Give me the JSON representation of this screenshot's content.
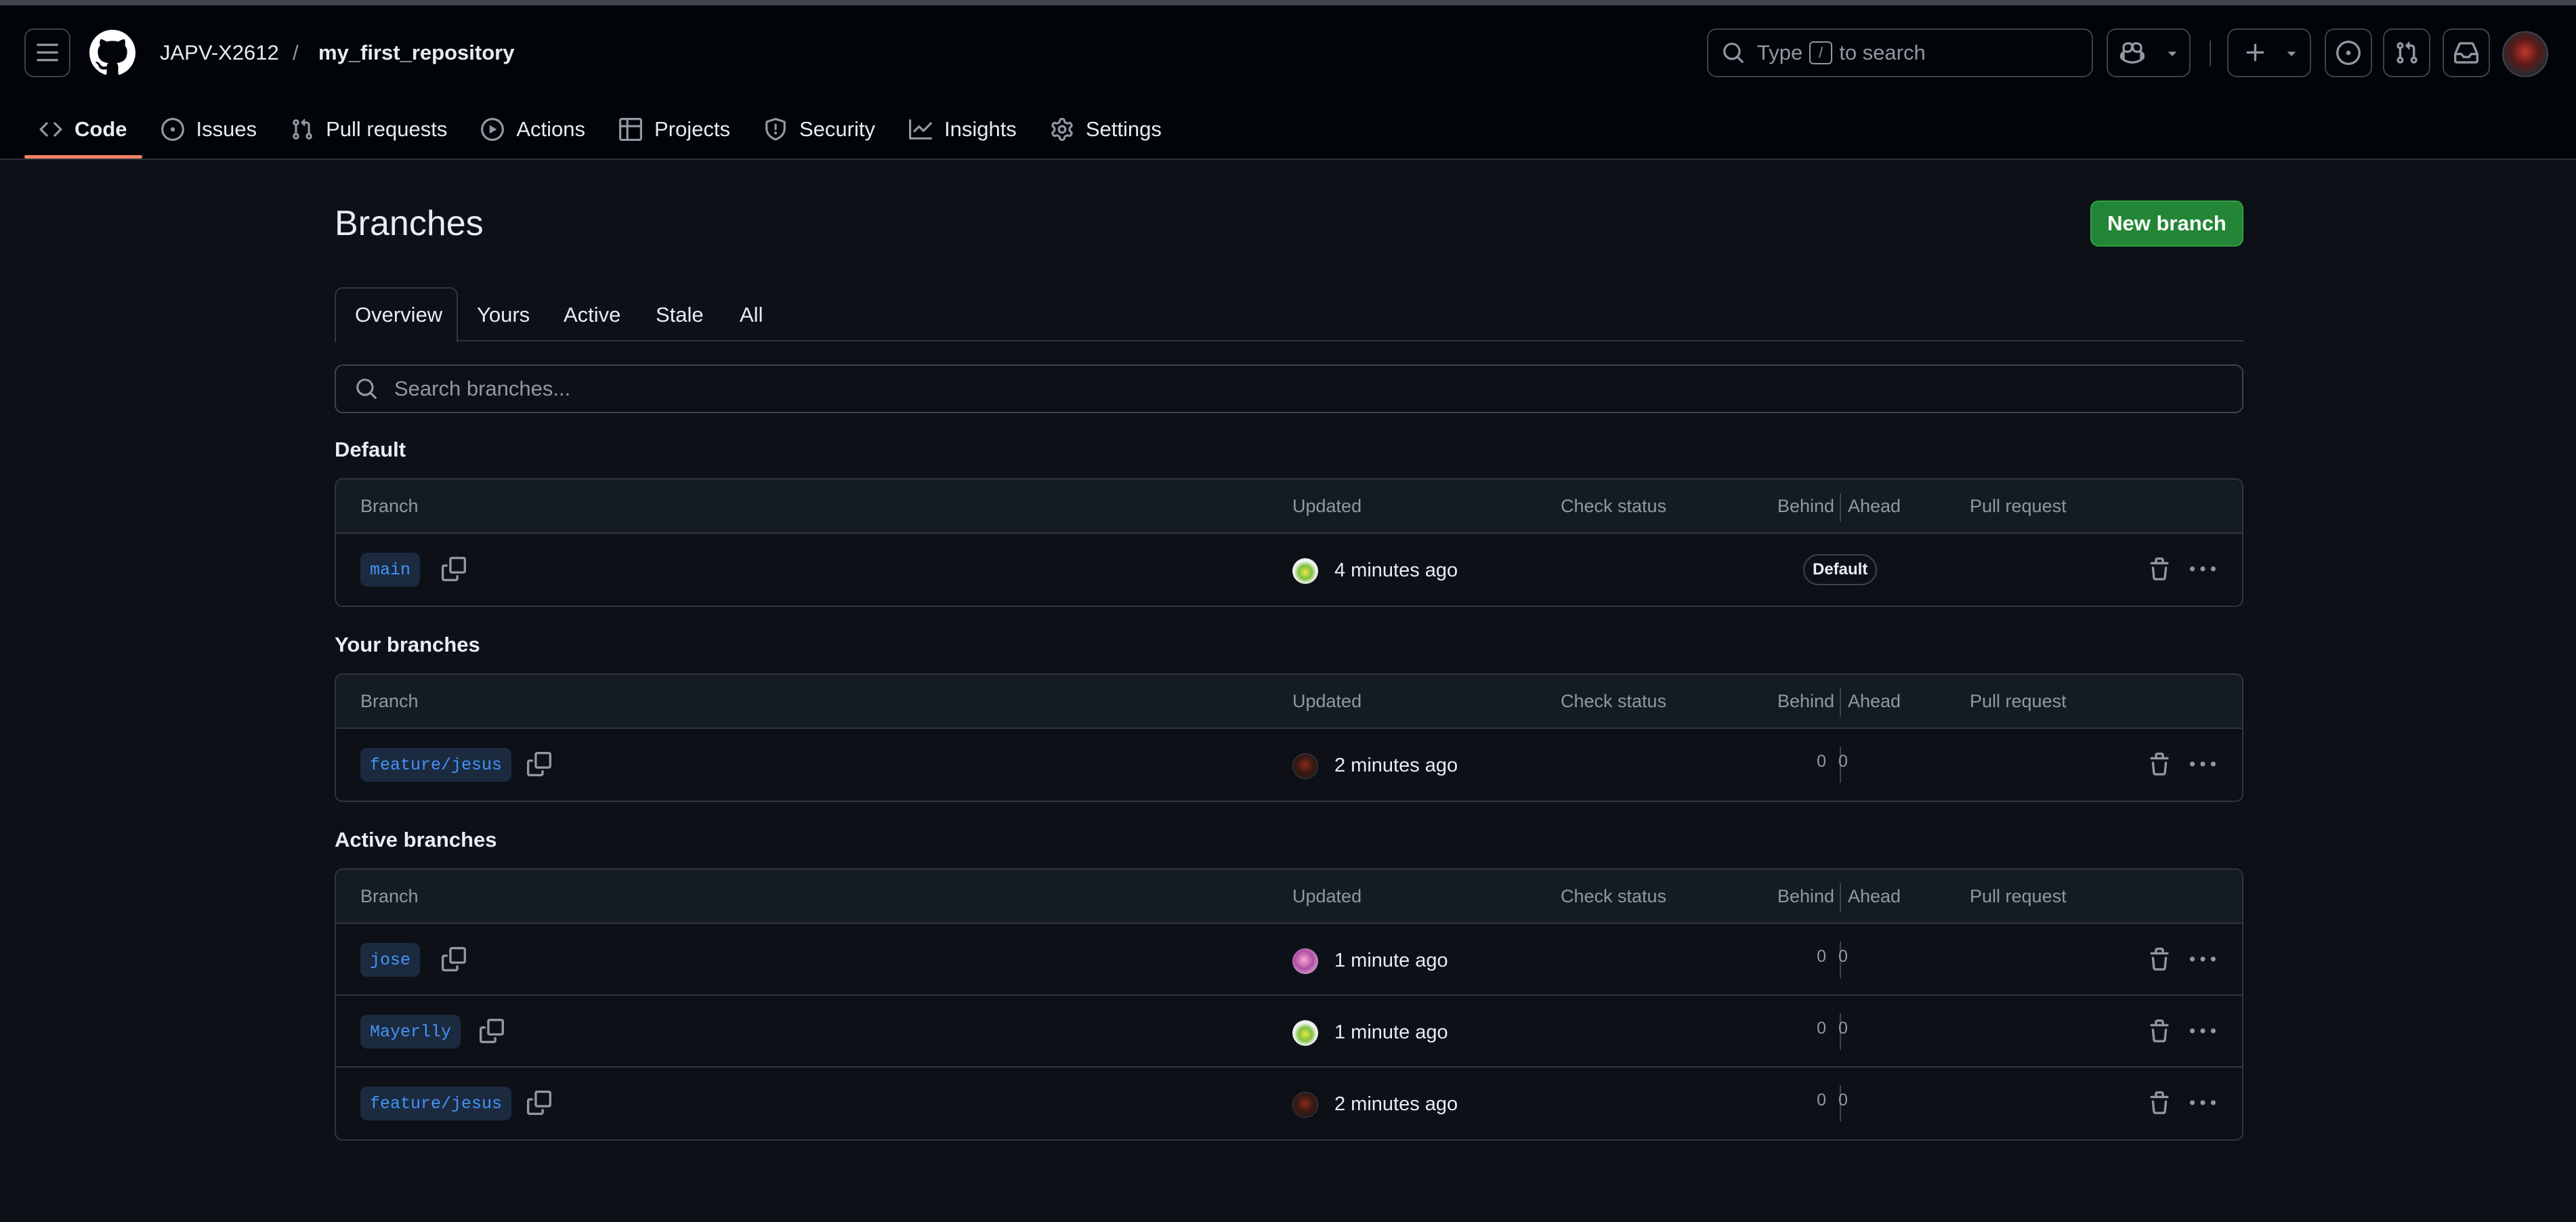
{
  "header": {
    "owner": "JAPV-X2612",
    "separator": "/",
    "repo": "my_first_repository",
    "search_prefix": "Type",
    "search_key": "/",
    "search_suffix": "to search"
  },
  "repo_nav": [
    {
      "label": "Code",
      "icon": "code-icon",
      "active": true
    },
    {
      "label": "Issues",
      "icon": "issue-icon"
    },
    {
      "label": "Pull requests",
      "icon": "pull-request-icon"
    },
    {
      "label": "Actions",
      "icon": "play-icon"
    },
    {
      "label": "Projects",
      "icon": "table-icon"
    },
    {
      "label": "Security",
      "icon": "shield-icon"
    },
    {
      "label": "Insights",
      "icon": "graph-icon"
    },
    {
      "label": "Settings",
      "icon": "gear-icon"
    }
  ],
  "page": {
    "title": "Branches",
    "new_branch_label": "New branch",
    "tabs": [
      "Overview",
      "Yours",
      "Active",
      "Stale",
      "All"
    ],
    "search_placeholder": "Search branches..."
  },
  "columns": {
    "branch": "Branch",
    "updated": "Updated",
    "check_status": "Check status",
    "behind": "Behind",
    "ahead": "Ahead",
    "pull_request": "Pull request"
  },
  "sections": [
    {
      "title": "Default",
      "rows": [
        {
          "name": "main",
          "updated": "4 minutes ago",
          "avatar": "green",
          "badge": "Default"
        }
      ]
    },
    {
      "title": "Your branches",
      "rows": [
        {
          "name": "feature/jesus",
          "updated": "2 minutes ago",
          "avatar": "dark",
          "behind": "0",
          "ahead": "0"
        }
      ]
    },
    {
      "title": "Active branches",
      "rows": [
        {
          "name": "jose",
          "updated": "1 minute ago",
          "avatar": "pink",
          "behind": "0",
          "ahead": "0"
        },
        {
          "name": "Mayerlly",
          "updated": "1 minute ago",
          "avatar": "green",
          "behind": "0",
          "ahead": "0"
        },
        {
          "name": "feature/jesus",
          "updated": "2 minutes ago",
          "avatar": "dark",
          "behind": "0",
          "ahead": "0"
        }
      ]
    }
  ],
  "colors": {
    "background": "#0d1117",
    "header_bg": "#010409",
    "accent_underline": "#f78166",
    "primary_button": "#238636",
    "branch_link": "#4493f8"
  }
}
